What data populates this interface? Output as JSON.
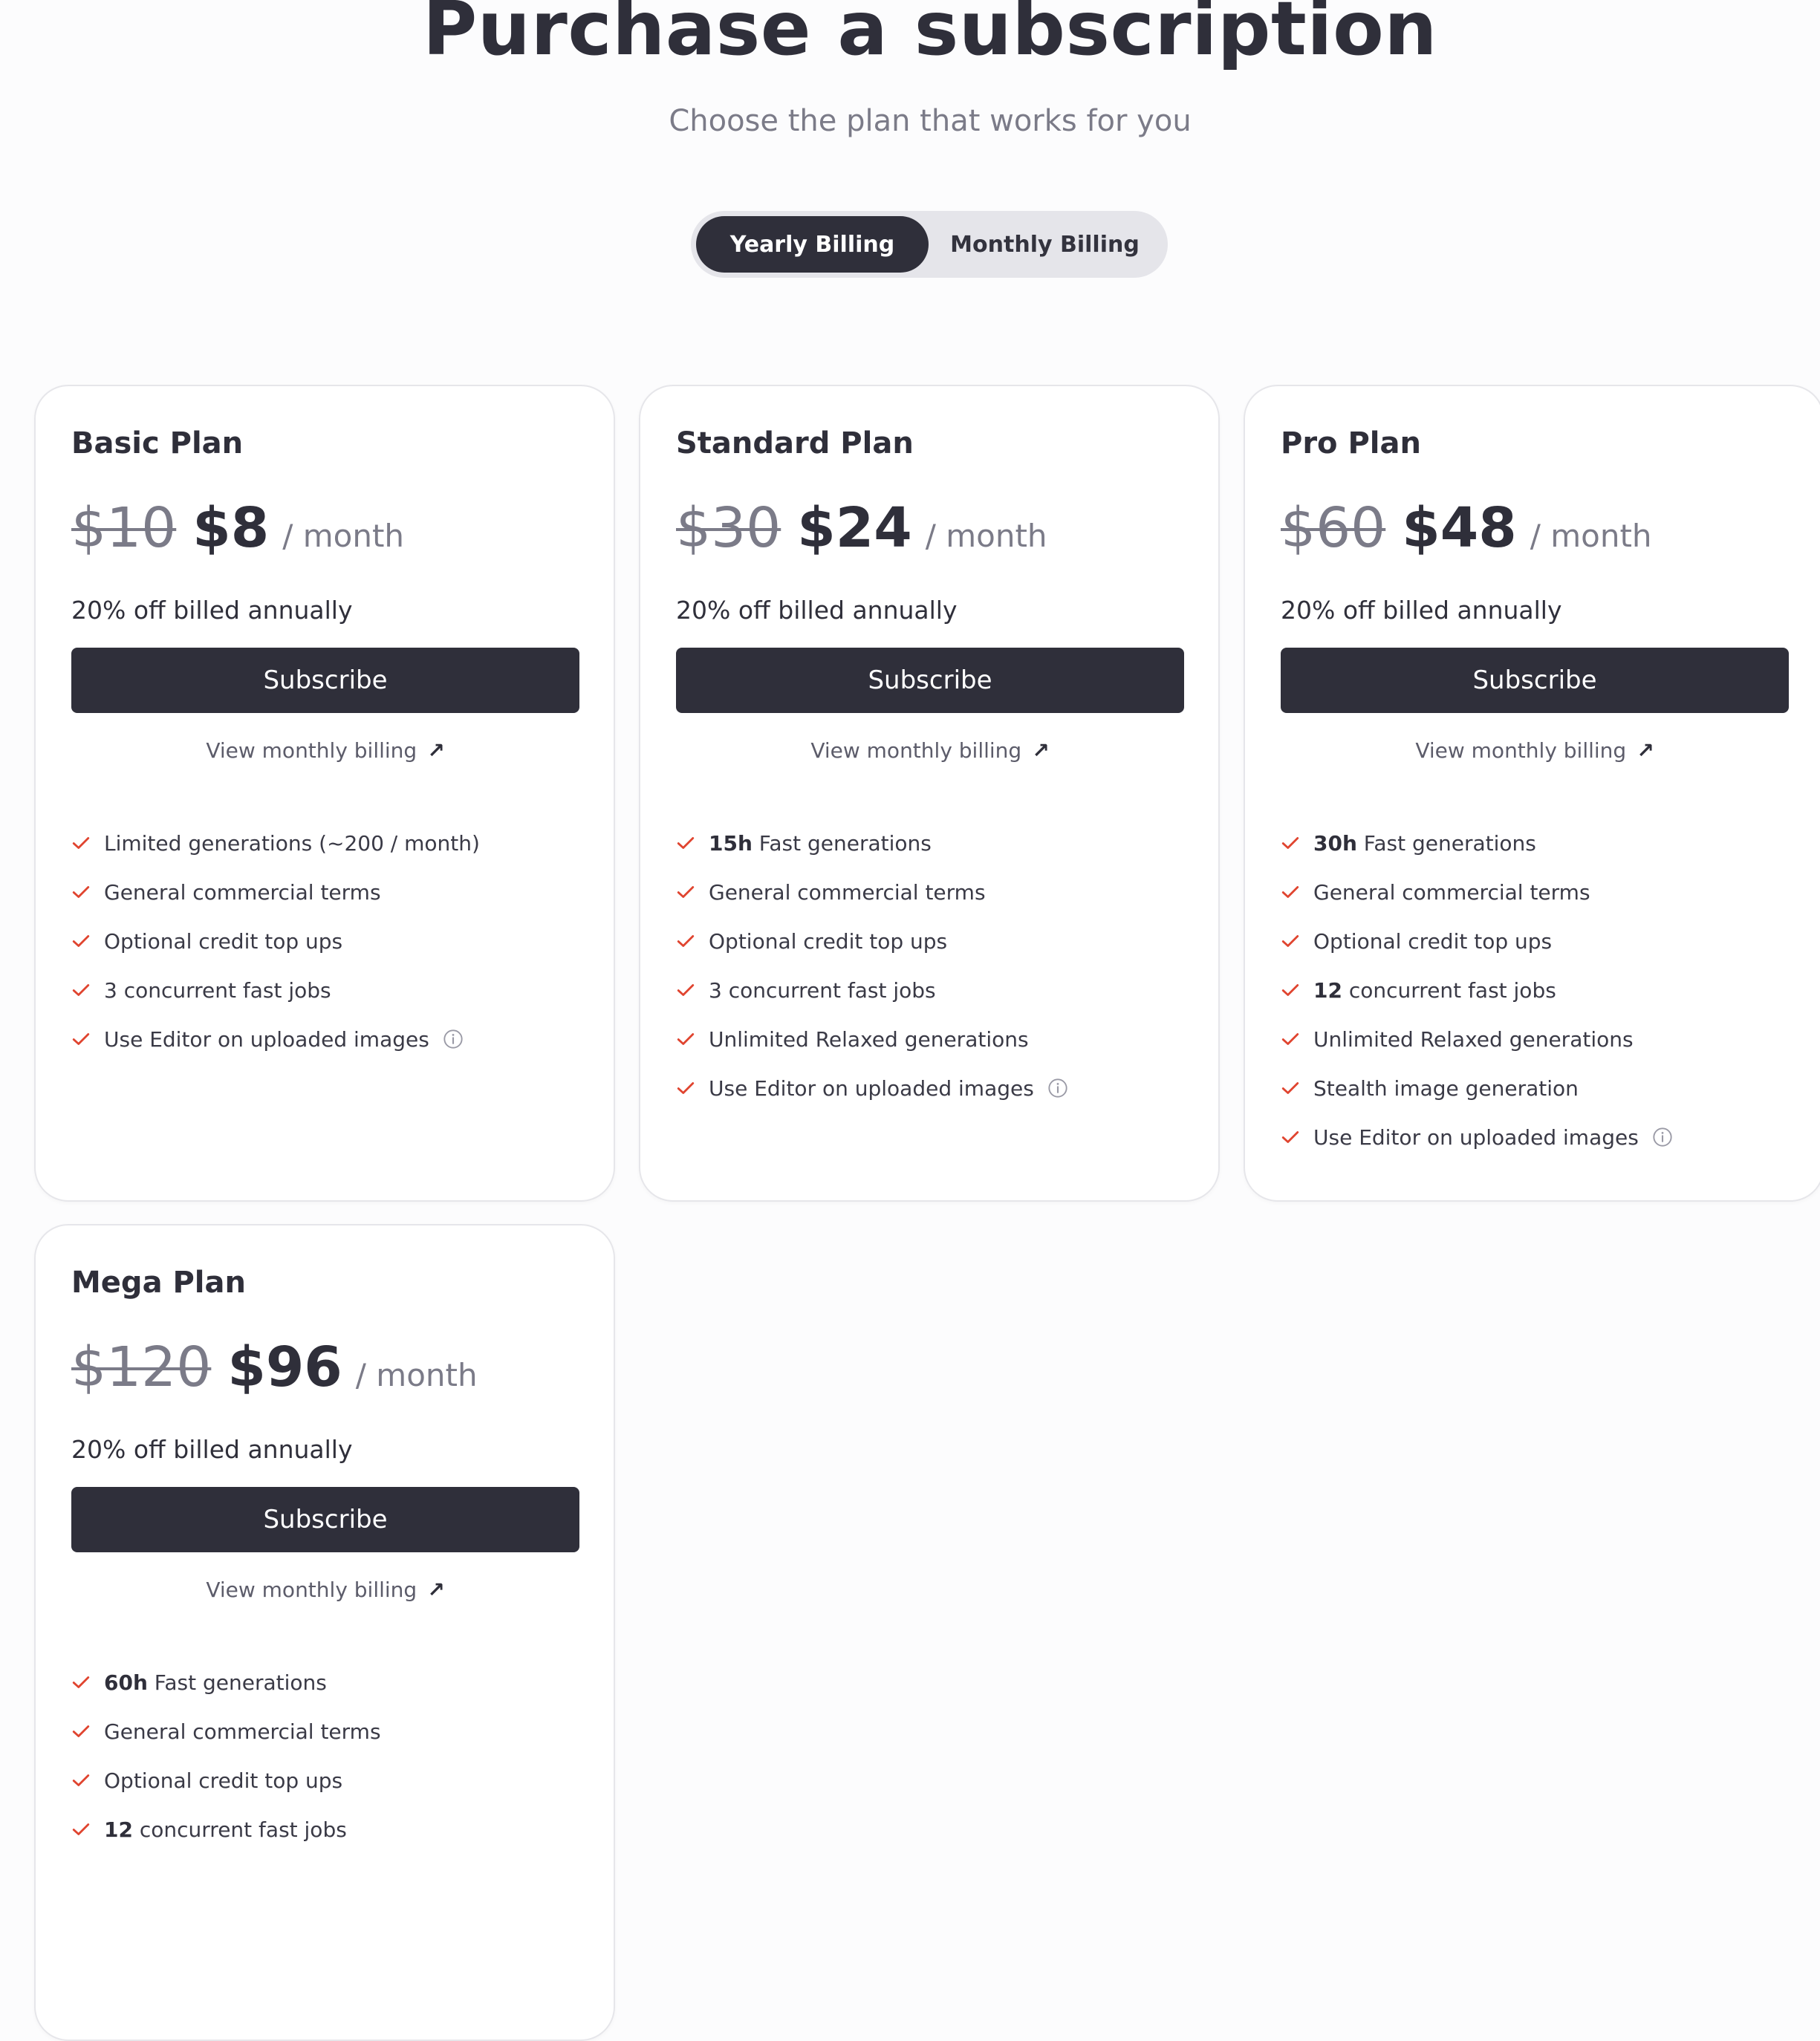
{
  "header": {
    "title": "Purchase a subscription",
    "subtitle": "Choose the plan that works for you"
  },
  "billing_toggle": {
    "options": [
      "Yearly Billing",
      "Monthly Billing"
    ],
    "selected": "Yearly Billing"
  },
  "colors": {
    "primary": "#2f2f3a",
    "check": "#e0442f",
    "muted": "#7b7b88",
    "toggle_track": "#e5e5ea"
  },
  "plans": [
    {
      "name": "Basic Plan",
      "original_price": "$10",
      "price": "$8",
      "period": "/ month",
      "discount": "20% off billed annually",
      "subscribe_label": "Subscribe",
      "monthly_link": "View monthly billing",
      "features": [
        {
          "bold": "",
          "text": "Limited generations (~200 / month)",
          "info": false
        },
        {
          "bold": "",
          "text": "General commercial terms",
          "info": false
        },
        {
          "bold": "",
          "text": "Optional credit top ups",
          "info": false
        },
        {
          "bold": "",
          "text": "3 concurrent fast jobs",
          "info": false
        },
        {
          "bold": "",
          "text": "Use Editor on uploaded images",
          "info": true
        }
      ]
    },
    {
      "name": "Standard Plan",
      "original_price": "$30",
      "price": "$24",
      "period": "/ month",
      "discount": "20% off billed annually",
      "subscribe_label": "Subscribe",
      "monthly_link": "View monthly billing",
      "features": [
        {
          "bold": "15h",
          "text": " Fast generations",
          "info": false
        },
        {
          "bold": "",
          "text": "General commercial terms",
          "info": false
        },
        {
          "bold": "",
          "text": "Optional credit top ups",
          "info": false
        },
        {
          "bold": "",
          "text": "3 concurrent fast jobs",
          "info": false
        },
        {
          "bold": "",
          "text": "Unlimited Relaxed generations",
          "info": false
        },
        {
          "bold": "",
          "text": "Use Editor on uploaded images",
          "info": true
        }
      ]
    },
    {
      "name": "Pro Plan",
      "original_price": "$60",
      "price": "$48",
      "period": "/ month",
      "discount": "20% off billed annually",
      "subscribe_label": "Subscribe",
      "monthly_link": "View monthly billing",
      "features": [
        {
          "bold": "30h",
          "text": " Fast generations",
          "info": false
        },
        {
          "bold": "",
          "text": "General commercial terms",
          "info": false
        },
        {
          "bold": "",
          "text": "Optional credit top ups",
          "info": false
        },
        {
          "bold": "12",
          "text": " concurrent fast jobs",
          "info": false
        },
        {
          "bold": "",
          "text": "Unlimited Relaxed generations",
          "info": false
        },
        {
          "bold": "",
          "text": "Stealth image generation",
          "info": false
        },
        {
          "bold": "",
          "text": "Use Editor on uploaded images",
          "info": true
        }
      ]
    },
    {
      "name": "Mega Plan",
      "original_price": "$120",
      "price": "$96",
      "period": "/ month",
      "discount": "20% off billed annually",
      "subscribe_label": "Subscribe",
      "monthly_link": "View monthly billing",
      "features": [
        {
          "bold": "60h",
          "text": " Fast generations",
          "info": false
        },
        {
          "bold": "",
          "text": "General commercial terms",
          "info": false
        },
        {
          "bold": "",
          "text": "Optional credit top ups",
          "info": false
        },
        {
          "bold": "12",
          "text": " concurrent fast jobs",
          "info": false
        }
      ]
    }
  ]
}
